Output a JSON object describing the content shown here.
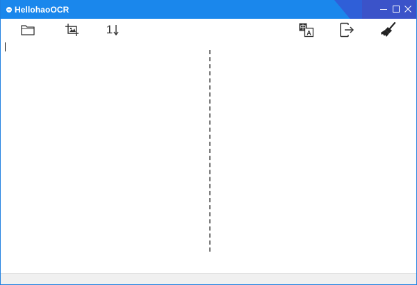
{
  "app": {
    "title": "HellohaoOCR",
    "icon_text": "oa",
    "accent_color": "#1a87ec"
  },
  "window_controls": [
    {
      "name": "minimize",
      "icon": "minimize-icon"
    },
    {
      "name": "maximize",
      "icon": "maximize-icon"
    },
    {
      "name": "close",
      "icon": "close-icon"
    }
  ],
  "toolbar": {
    "left": [
      {
        "id": "open",
        "icon": "folder-icon"
      },
      {
        "id": "image",
        "icon": "image-crop-icon"
      },
      {
        "id": "sort",
        "icon": "sort-icon",
        "label": "1"
      }
    ],
    "right": [
      {
        "id": "translate",
        "icon": "translate-icon",
        "label_cn": "中",
        "label_en": "A"
      },
      {
        "id": "export",
        "icon": "export-icon"
      },
      {
        "id": "clear",
        "icon": "broom-icon"
      }
    ]
  },
  "editor": {
    "left_text": "",
    "right_text": ""
  }
}
